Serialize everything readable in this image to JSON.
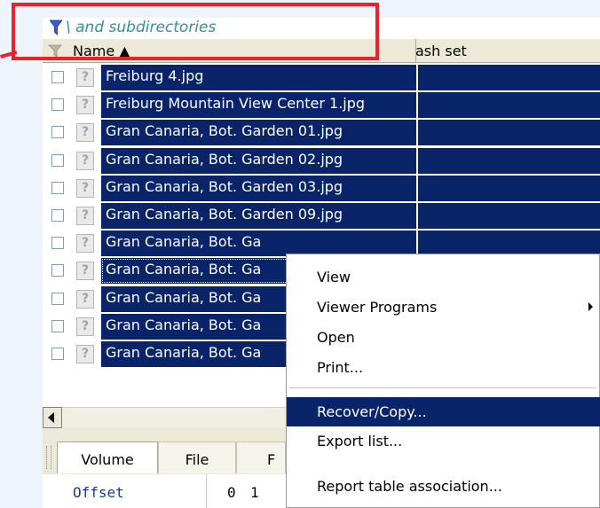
{
  "filter": {
    "icon": "funnel-icon",
    "text": "\\ and subdirectories",
    "color": "#2f8fa4"
  },
  "annotation": {
    "color": "#e8232b"
  },
  "columns": {
    "name": "Name",
    "hash": "ash set"
  },
  "selection_color": "#0a246a",
  "files": [
    "Freiburg 4.jpg",
    "Freiburg Mountain View Center 1.jpg",
    "Gran Canaria, Bot. Garden 01.jpg",
    "Gran Canaria, Bot. Garden 02.jpg",
    "Gran Canaria, Bot. Garden 03.jpg",
    "Gran Canaria, Bot. Garden 09.jpg",
    "Gran Canaria, Bot. Ga",
    "Gran Canaria, Bot. Ga",
    "Gran Canaria, Bot. Ga",
    "Gran Canaria, Bot. Ga",
    "Gran Canaria, Bot. Ga"
  ],
  "tabs": [
    "Volume",
    "File",
    "F"
  ],
  "offset": {
    "label": "Offset",
    "value1": "0",
    "value2": "1"
  },
  "context_menu": {
    "items": [
      {
        "label": "View"
      },
      {
        "label": "Viewer Programs",
        "submenu": true
      },
      {
        "label": "Open"
      },
      {
        "label": "Print..."
      },
      {
        "label": "Recover/Copy...",
        "highlighted": true
      },
      {
        "label": "Export list..."
      },
      {
        "label": "Report table association..."
      }
    ]
  }
}
